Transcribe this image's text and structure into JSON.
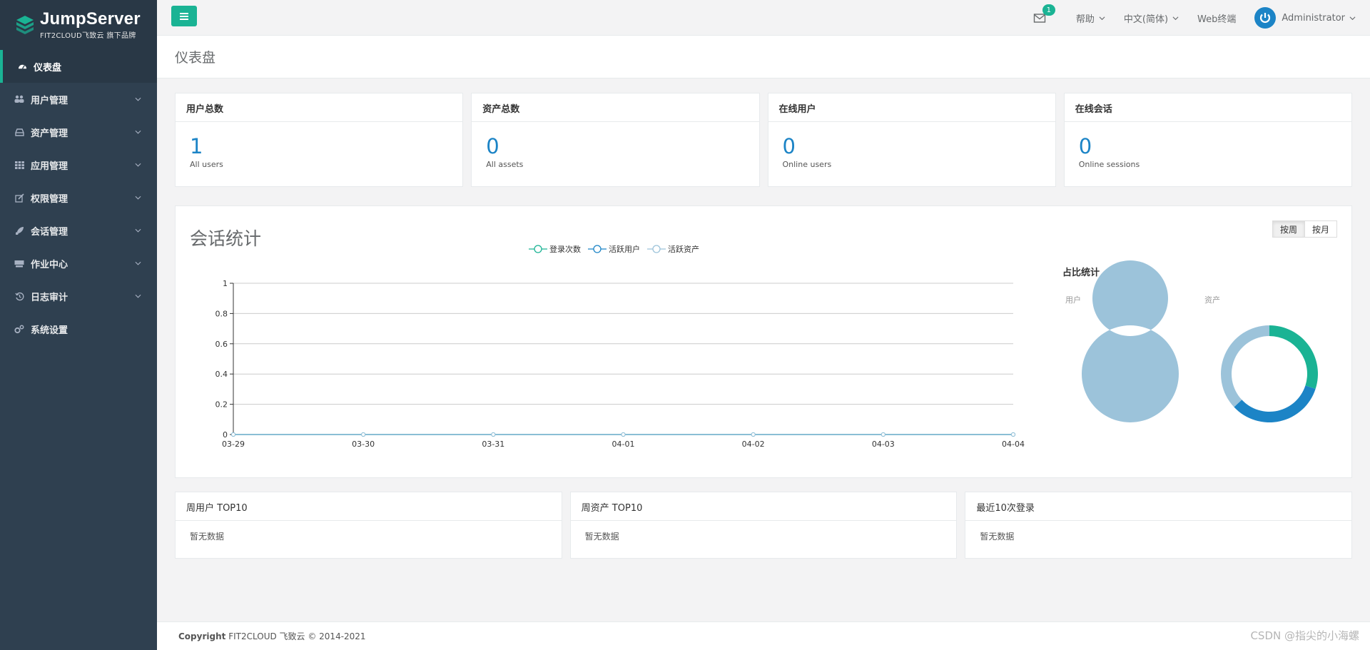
{
  "brand": {
    "name": "JumpServer",
    "subtitle": "FIT2CLOUD飞致云 旗下品牌",
    "accent": "#1ab394"
  },
  "sidebar": {
    "items": [
      {
        "label": "仪表盘",
        "icon": "dashboard-icon",
        "active": true
      },
      {
        "label": "用户管理",
        "icon": "users-icon"
      },
      {
        "label": "资产管理",
        "icon": "inbox-icon"
      },
      {
        "label": "应用管理",
        "icon": "grid-icon"
      },
      {
        "label": "权限管理",
        "icon": "edit-icon"
      },
      {
        "label": "会话管理",
        "icon": "rocket-icon"
      },
      {
        "label": "作业中心",
        "icon": "keyboard-icon"
      },
      {
        "label": "日志审计",
        "icon": "history-icon"
      },
      {
        "label": "系统设置",
        "icon": "gears-icon"
      }
    ]
  },
  "topbar": {
    "mail_badge": "1",
    "help": "帮助",
    "language": "中文(简体)",
    "web_terminal": "Web终端",
    "user": "Administrator"
  },
  "page": {
    "title": "仪表盘"
  },
  "stats": [
    {
      "title": "用户总数",
      "value": "1",
      "label": "All users"
    },
    {
      "title": "资产总数",
      "value": "0",
      "label": "All assets"
    },
    {
      "title": "在线用户",
      "value": "0",
      "label": "Online users"
    },
    {
      "title": "在线会话",
      "value": "0",
      "label": "Online sessions"
    }
  ],
  "session": {
    "title": "会话统计",
    "period_week": "按周",
    "period_month": "按月",
    "ratio_title": "占比统计",
    "donut_user_label": "用户",
    "donut_asset_label": "资产"
  },
  "chart_data": {
    "type": "line",
    "x": [
      "03-29",
      "03-30",
      "03-31",
      "04-01",
      "04-02",
      "04-03",
      "04-04"
    ],
    "series": [
      {
        "name": "登录次数",
        "values": [
          0,
          0,
          0,
          0,
          0,
          0,
          0
        ],
        "color": "#1ab394"
      },
      {
        "name": "活跃用户",
        "values": [
          0,
          0,
          0,
          0,
          0,
          0,
          0
        ],
        "color": "#1c84c6"
      },
      {
        "name": "活跃资产",
        "values": [
          0,
          0,
          0,
          0,
          0,
          0,
          0
        ],
        "color": "#9cc3da"
      }
    ],
    "ylim": [
      0,
      1
    ],
    "yticks": [
      "0",
      "0.2",
      "0.4",
      "0.6",
      "0.8",
      "1"
    ],
    "grid": true,
    "legend": "top-center",
    "donuts": {
      "user": [
        {
          "value": 1,
          "color": "#9cc3da"
        }
      ],
      "asset": [
        {
          "value": 0.3,
          "color": "#1ab394"
        },
        {
          "value": 0.33,
          "color": "#1c84c6"
        },
        {
          "value": 0.37,
          "color": "#9cc3da"
        }
      ]
    }
  },
  "bottom": [
    {
      "title": "周用户 TOP10",
      "empty": "暂无数据"
    },
    {
      "title": "周资产 TOP10",
      "empty": "暂无数据"
    },
    {
      "title": "最近10次登录",
      "empty": "暂无数据"
    }
  ],
  "footer": {
    "copyright_label": "Copyright",
    "copyright_text": "FIT2CLOUD 飞致云 © 2014-2021",
    "watermark": "CSDN @指尖的小海螺"
  }
}
